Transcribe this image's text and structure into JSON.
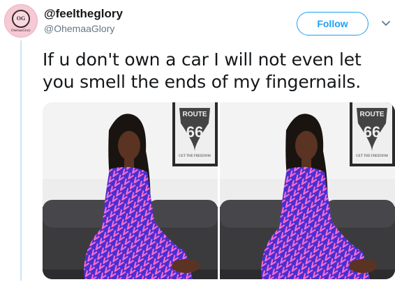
{
  "tweet": {
    "display_name": "@feeltheglory",
    "handle": "@OhemaaGlory",
    "follow_label": "Follow",
    "text": "If u don't own a car I will not even let you smell the ends of my fingernails.",
    "avatar_monogram": "OG",
    "avatar_brand": "OhemaaGlory"
  },
  "media": {
    "sign_top": "ROUTE",
    "sign_number": "66",
    "sign_bottom": "GET THE FREEDOM"
  },
  "colors": {
    "accent": "#1da1f2",
    "thread_line": "#cfe3f3",
    "dress_purple": "#4a2fd0",
    "dress_pink": "#ff6fd0"
  },
  "icons": {
    "menu": "chevron-down-icon"
  }
}
